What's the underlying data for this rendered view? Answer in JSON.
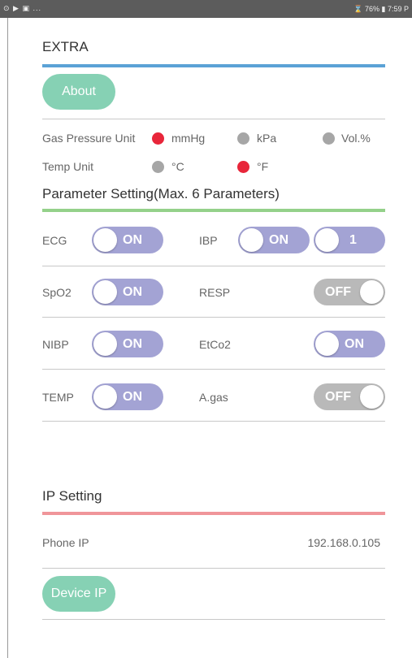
{
  "status_bar": {
    "left_icons": "⊙ ▶ ▣ ...",
    "right_text": "⌛ 76% ▮ 7:59 P"
  },
  "extra": {
    "title": "EXTRA",
    "about_label": "About",
    "gas_pressure": {
      "label": "Gas Pressure Unit",
      "options": [
        {
          "label": "mmHg",
          "selected": true
        },
        {
          "label": "kPa",
          "selected": false
        },
        {
          "label": "Vol.%",
          "selected": false
        }
      ]
    },
    "temp_unit": {
      "label": "Temp Unit",
      "options": [
        {
          "label": "°C",
          "selected": false
        },
        {
          "label": "°F",
          "selected": true
        }
      ]
    }
  },
  "parameters": {
    "title": "Parameter Setting(Max. 6 Parameters)",
    "ecg": {
      "label": "ECG",
      "state": "ON"
    },
    "ibp": {
      "label": "IBP",
      "state": "ON",
      "channel": "1"
    },
    "spo2": {
      "label": "SpO2",
      "state": "ON"
    },
    "resp": {
      "label": "RESP",
      "state": "OFF"
    },
    "nibp": {
      "label": "NIBP",
      "state": "ON"
    },
    "etco2": {
      "label": "EtCo2",
      "state": "ON"
    },
    "temp": {
      "label": "TEMP",
      "state": "ON"
    },
    "agas": {
      "label": "A.gas",
      "state": "OFF"
    }
  },
  "ip_setting": {
    "title": "IP Setting",
    "phone_ip_label": "Phone IP",
    "phone_ip_value": "192.168.0.105",
    "device_ip_label": "Device IP"
  },
  "colors": {
    "accent_mint": "#86d1b4",
    "toggle_on": "#a3a3d4",
    "toggle_off": "#b9b9b9",
    "radio_selected": "#e8263a",
    "rule_extra": "#5ba2d6",
    "rule_parameters": "#94d18a",
    "rule_ip": "#f0959a"
  }
}
